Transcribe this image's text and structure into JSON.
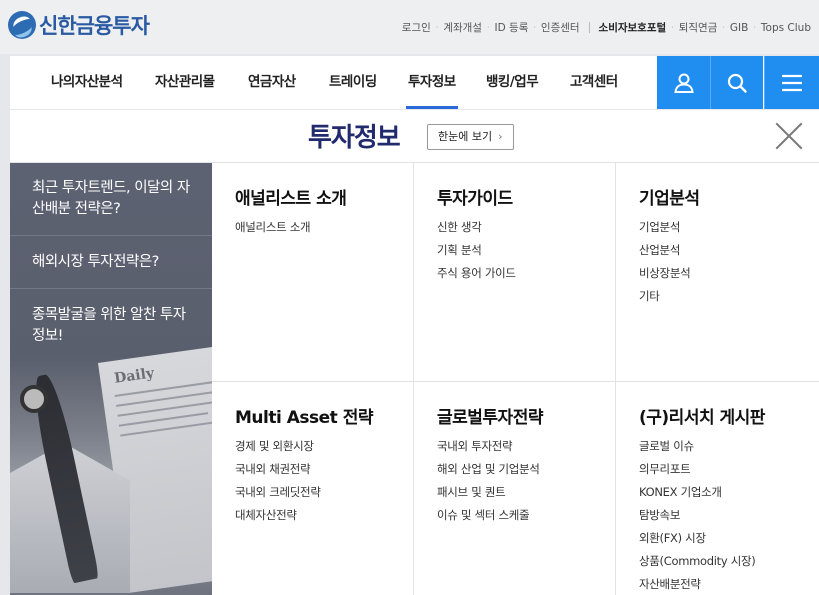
{
  "header": {
    "logo_text": "신한금융투자",
    "util_links": [
      {
        "label": "로그인"
      },
      {
        "label": "계좌개설"
      },
      {
        "label": "ID 등록"
      },
      {
        "label": "인증센터"
      },
      {
        "label": "소비자보호포털",
        "strong": true
      },
      {
        "label": "퇴직연금"
      },
      {
        "label": "GIB"
      },
      {
        "label": "Tops Club"
      }
    ]
  },
  "nav": {
    "items": [
      {
        "label": "나의자산분석"
      },
      {
        "label": "자산관리몰"
      },
      {
        "label": "연금자산"
      },
      {
        "label": "트레이딩"
      },
      {
        "label": "투자정보",
        "active": true
      },
      {
        "label": "뱅킹/업무"
      },
      {
        "label": "고객센터"
      }
    ],
    "icons": [
      "user-icon",
      "search-icon",
      "menu-icon"
    ],
    "accent_color": "#1f8ef0"
  },
  "panel": {
    "title": "투자정보",
    "overview_label": "한눈에 보기",
    "overview_chevron": "›",
    "promo_items": [
      {
        "label": "최근 투자트렌드, 이달의 자산배분 전략은?"
      },
      {
        "label": "해외시장 투자전략은?"
      },
      {
        "label": "종목발굴을 위한 알찬 투자정보!"
      }
    ],
    "promo_art_text": "Daily",
    "sections": [
      {
        "title": "애널리스트 소개",
        "links": [
          "애널리스트 소개"
        ]
      },
      {
        "title": "투자가이드",
        "links": [
          "신한 생각",
          "기획 분석",
          "주식 용어 가이드"
        ]
      },
      {
        "title": "기업분석",
        "links": [
          "기업분석",
          "산업분석",
          "비상장분석",
          "기타"
        ]
      },
      {
        "title": "Multi Asset 전략",
        "links": [
          "경제 및 외환시장",
          "국내외 채권전략",
          "국내외 크레딧전략",
          "대체자산전략"
        ]
      },
      {
        "title": "글로벌투자전략",
        "links": [
          "국내외 투자전략",
          "해외 산업 및 기업분석",
          "패시브 및 퀀트",
          "이슈 및 섹터 스케줄"
        ]
      },
      {
        "title": "(구)리서치 게시판",
        "links": [
          "글로벌 이슈",
          "의무리포트",
          "KONEX 기업소개",
          "탐방속보",
          "외환(FX) 시장",
          "상품(Commodity 시장)",
          "자산배분전략"
        ]
      }
    ]
  }
}
